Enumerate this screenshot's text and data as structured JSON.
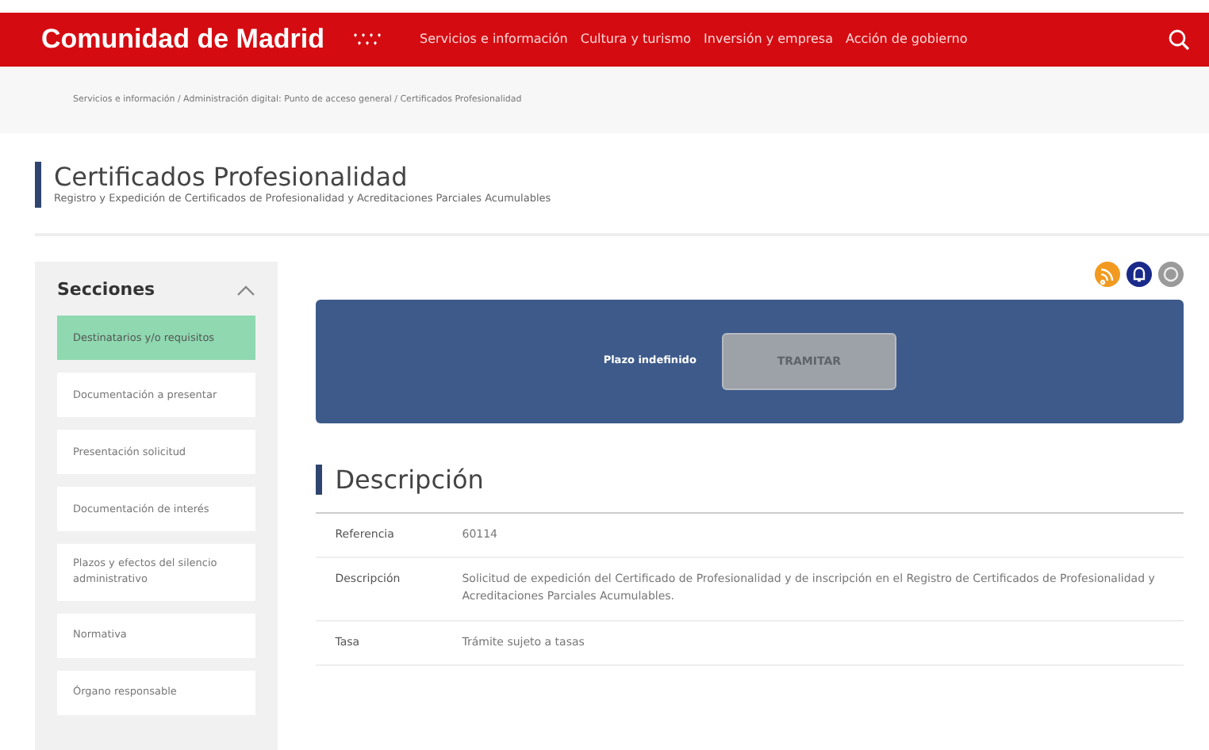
{
  "header": {
    "brand": "Comunidad de Madrid",
    "nav": [
      {
        "label": "Servicios e información"
      },
      {
        "label": "Cultura y turismo"
      },
      {
        "label": "Inversión y empresa"
      },
      {
        "label": "Acción de gobierno"
      }
    ]
  },
  "breadcrumb": "Servicios e información / Administración digital: Punto de acceso general / Certificados Profesionalidad",
  "page": {
    "title": "Certificados Profesionalidad",
    "subtitle": "Registro y Expedición de Certificados de Profesionalidad y Acreditaciones Parciales Acumulables"
  },
  "sidebar": {
    "title": "Secciones",
    "expanded": true,
    "items": [
      {
        "label": "Destinatarios y/o requisitos",
        "selected": true
      },
      {
        "label": "Documentación a presentar",
        "selected": false
      },
      {
        "label": "Presentación solicitud",
        "selected": false
      },
      {
        "label": "Documentación de interés",
        "selected": false
      },
      {
        "label": "Plazos y efectos del silencio administrativo",
        "selected": false
      },
      {
        "label": "Normativa",
        "selected": false
      },
      {
        "label": "Órgano responsable",
        "selected": false
      }
    ]
  },
  "banner": {
    "label": "Plazo indefinido",
    "button": {
      "label": "TRAMITAR",
      "disabled": true
    }
  },
  "description": {
    "title": "Descripción",
    "rows": [
      {
        "label": "Referencia",
        "value": "60114"
      },
      {
        "label": "Descripción",
        "value": "Solicitud de expedición del Certificado de Profesionalidad y de inscripción en el Registro de Certificados de Profesionalidad y Acreditaciones Parciales Acumulables."
      },
      {
        "label": "Tasa",
        "value": "Trámite sujeto a tasas"
      }
    ]
  }
}
